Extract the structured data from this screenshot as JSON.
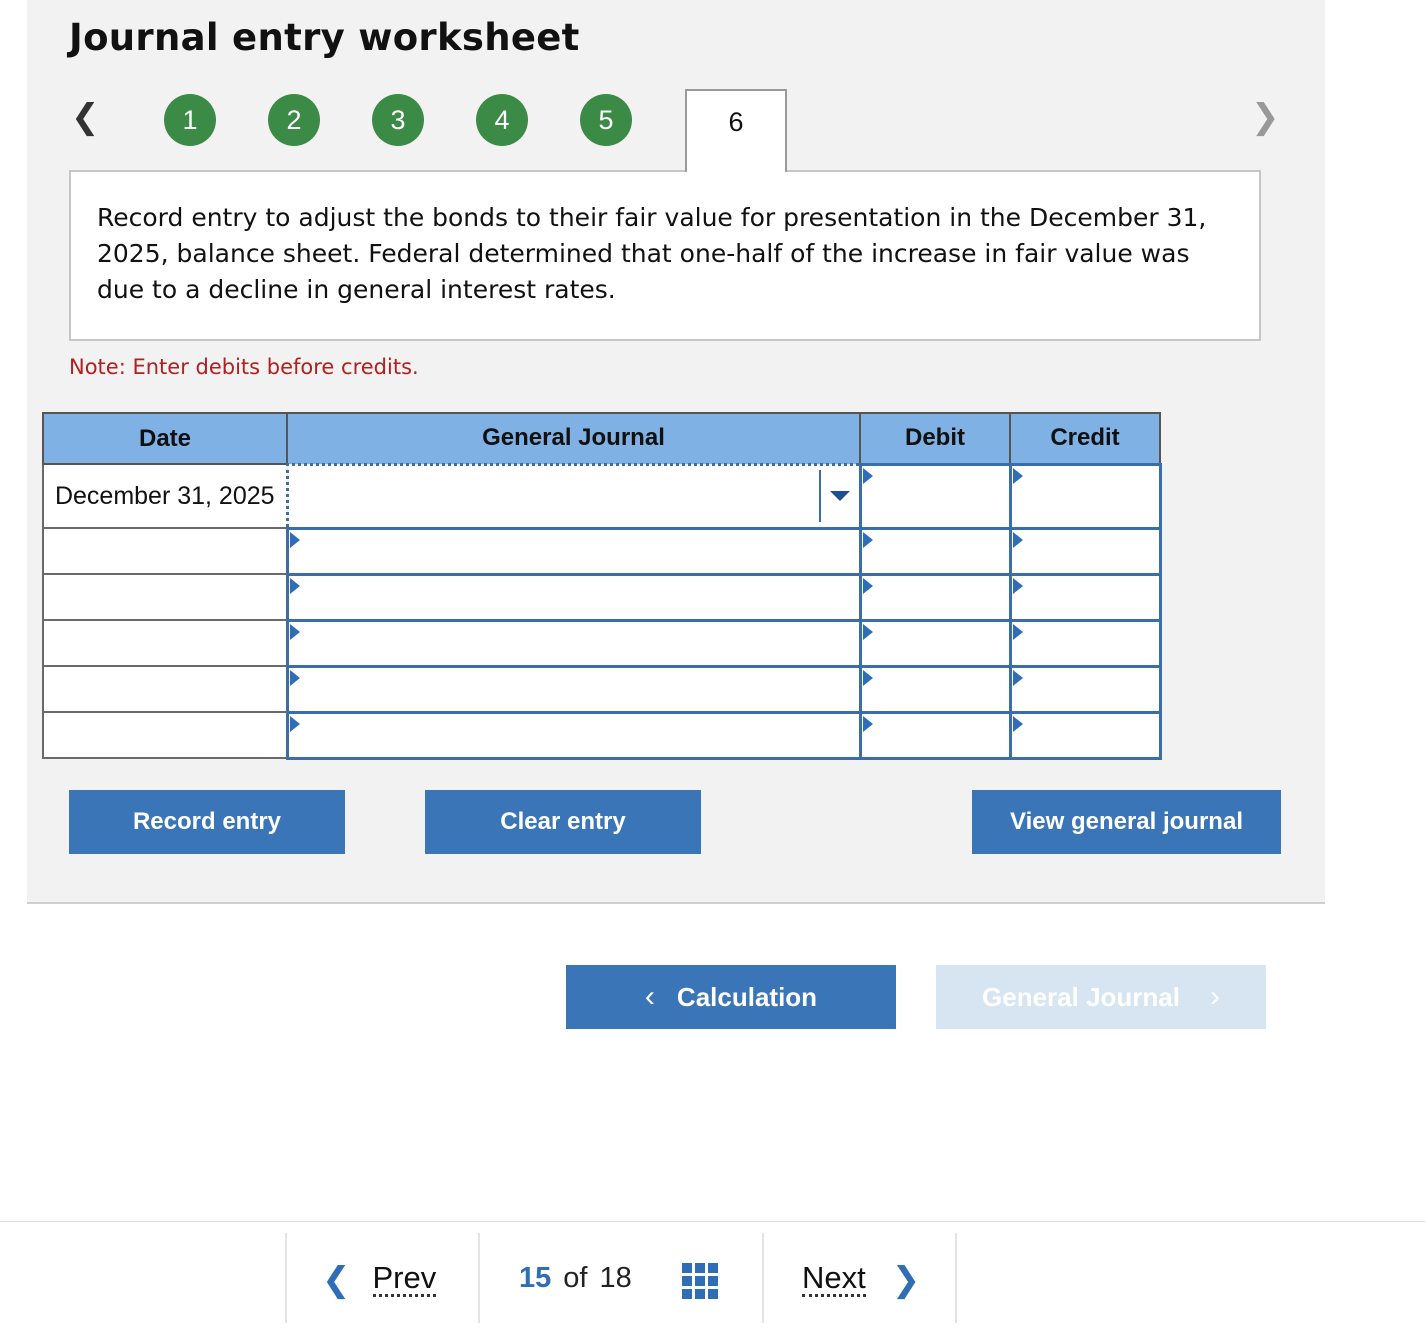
{
  "worksheet": {
    "title": "Journal entry worksheet",
    "steps": [
      "1",
      "2",
      "3",
      "4",
      "5"
    ],
    "active_step": "6",
    "prompt": "Record entry to adjust the bonds to their fair value for presentation in the December 31, 2025, balance sheet. Federal determined that one-half of the increase in fair value was due to a decline in general interest rates.",
    "note": "Note: Enter debits before credits."
  },
  "table": {
    "headers": {
      "date": "Date",
      "journal": "General Journal",
      "debit": "Debit",
      "credit": "Credit"
    },
    "first_date": "December 31, 2025"
  },
  "buttons": {
    "record": "Record entry",
    "clear": "Clear entry",
    "view": "View general journal",
    "calculation": "Calculation",
    "general_journal": "General Journal"
  },
  "pagination": {
    "prev": "Prev",
    "current": "15",
    "of": "of",
    "total": "18",
    "next": "Next"
  },
  "colors": {
    "step_green": "#3b8a45",
    "button_blue": "#3a75b8",
    "header_blue": "#7fb1e4",
    "note_red": "#b41e1e"
  }
}
